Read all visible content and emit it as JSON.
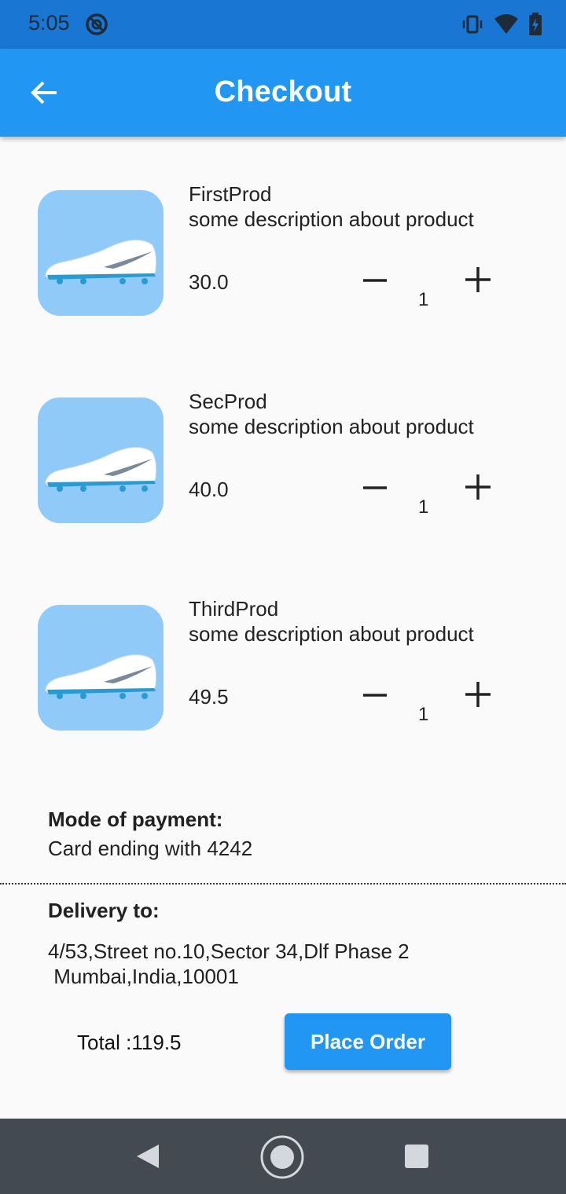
{
  "status_bar": {
    "time": "5:05",
    "left_icon": "do-not-disturb-icon",
    "right_icons": [
      "vibrate-icon",
      "wifi-icon",
      "battery-charging-icon"
    ]
  },
  "app_bar": {
    "title": "Checkout",
    "back_icon": "arrow-back-icon"
  },
  "products": [
    {
      "name": "FirstProd",
      "description": "some description about product",
      "price": "30.0",
      "quantity": "1",
      "image": "football-boot-image"
    },
    {
      "name": "SecProd",
      "description": "some description about product",
      "price": "40.0",
      "quantity": "1",
      "image": "football-boot-image"
    },
    {
      "name": "ThirdProd",
      "description": "some description about product",
      "price": "49.5",
      "quantity": "1",
      "image": "football-boot-image"
    }
  ],
  "payment": {
    "label": "Mode of payment:",
    "value": "Card ending with 4242"
  },
  "delivery": {
    "label": "Delivery to:",
    "address": "4/53,Street no.10,Sector 34,Dlf Phase 2\n Mumbai,India,10001"
  },
  "footer": {
    "total": "Total :119.5",
    "place_order_label": "Place Order"
  },
  "colors": {
    "app_bar": "#2196f3",
    "status_bar": "#1976d2",
    "product_bg": "#90caf9",
    "nav_bar": "#434a52"
  },
  "nav_bar": {
    "icons": [
      "nav-back-icon",
      "nav-home-icon",
      "nav-recents-icon"
    ]
  }
}
